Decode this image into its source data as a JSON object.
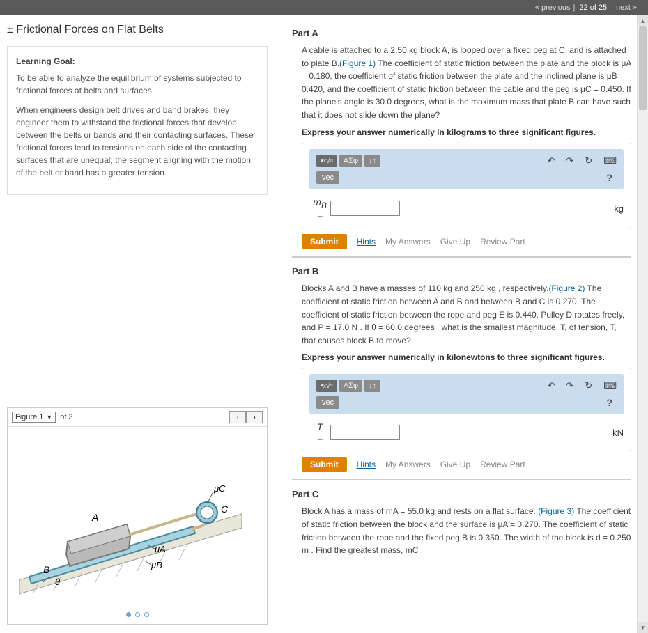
{
  "nav": {
    "previous": "« previous",
    "counter": "22 of 25",
    "next": "next »"
  },
  "title": "± Frictional Forces on Flat Belts",
  "learning_goal": {
    "label": "Learning Goal:",
    "p1": "To be able to analyze the equilibrium of systems subjected to frictional forces at belts and surfaces.",
    "p2": "When engineers design belt drives and band brakes, they engineer them to withstand the frictional forces that develop between the belts or bands and their contacting surfaces. These frictional forces lead to tensions on each side of the contacting surfaces that are unequal; the segment aligning with the motion of the belt or band has a greater tension."
  },
  "figure": {
    "label": "Figure 1",
    "of": "of 3",
    "labels": {
      "A": "A",
      "B": "B",
      "C": "C",
      "muA": "μA",
      "muB": "μB",
      "muC": "μC",
      "theta": "θ"
    }
  },
  "toolbar": {
    "vec": "vec",
    "greek": "ΑΣφ",
    "arrows": "↓↑"
  },
  "actions": {
    "submit": "Submit",
    "hints": "Hints",
    "my_answers": "My Answers",
    "give_up": "Give Up",
    "review": "Review Part"
  },
  "partA": {
    "label": "Part A",
    "q1": "A cable is attached to a 2.50 kg block A, is looped over a fixed peg at C, and is attached to plate B.",
    "figlink": "(Figure 1)",
    "q2": " The coefficient of static friction between the plate and the block is μA = 0.180, the coefficient of static friction between the plate and the inclined plane is μB = 0.420, and the coefficient of static friction between the cable and the peg is μC = 0.450. If the plane's angle is 30.0 degrees, what is the maximum mass that plate B can have such that it does not slide down the plane?",
    "instr": "Express your answer numerically in kilograms to three significant figures.",
    "var": "mB",
    "unit": "kg"
  },
  "partB": {
    "label": "Part B",
    "q1": "Blocks A and B have a masses of 110 kg and 250 kg , respectively.",
    "figlink": "(Figure 2)",
    "q2": " The coefficient of static friction between A and B and between B and C is 0.270. The coefficient of static friction between the rope and peg E is 0.440. Pulley D rotates freely, and P = 17.0 N . If θ = 60.0 degrees , what is the smallest magnitude, T, of tension, T, that causes block B to move?",
    "instr": "Express your answer numerically in kilonewtons to three significant figures.",
    "var": "T",
    "unit": "kN"
  },
  "partC": {
    "label": "Part C",
    "q1": "Block A has a mass of mA = 55.0 kg and rests on a flat surface. ",
    "figlink": "(Figure 3)",
    "q2": " The coefficient of static friction between the block and the surface is μA = 0.270. The coefficient of static friction between the rope and the fixed peg B is 0.350. The width of the block is d = 0.250 m . Find the greatest mass, mC ,"
  }
}
